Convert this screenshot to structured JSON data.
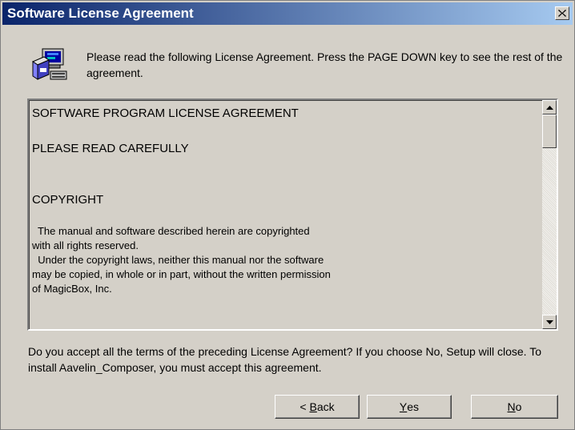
{
  "window": {
    "title": "Software License Agreement"
  },
  "icons": {
    "header": "setup-computer-icon",
    "close": "close-icon",
    "scroll_up": "arrow-up-icon",
    "scroll_down": "arrow-down-icon"
  },
  "intro": "Please read the following License Agreement.  Press the PAGE DOWN key to see the rest of the agreement.",
  "license": {
    "title": "SOFTWARE PROGRAM LICENSE AGREEMENT",
    "read_carefully": "PLEASE READ CAREFULLY",
    "copyright_heading": "COPYRIGHT",
    "lines": [
      "  The manual and software described herein are copyrighted",
      "with all rights reserved.",
      "  Under the copyright laws, neither this manual nor the software",
      "may be copied, in whole or in part, without the written permission",
      "of MagicBox, Inc."
    ]
  },
  "question": "Do you accept all the terms of the preceding License Agreement?  If you choose No,  Setup will close.  To install Aavelin_Composer, you must accept this agreement.",
  "buttons": {
    "back": {
      "prefix": "< ",
      "mnemonic": "B",
      "rest": "ack"
    },
    "yes": {
      "mnemonic": "Y",
      "rest": "es"
    },
    "no": {
      "mnemonic": "N",
      "rest": "o"
    }
  },
  "colors": {
    "titlebar_start": "#0a246a",
    "titlebar_end": "#a6caf0",
    "face": "#d4d0c8"
  }
}
